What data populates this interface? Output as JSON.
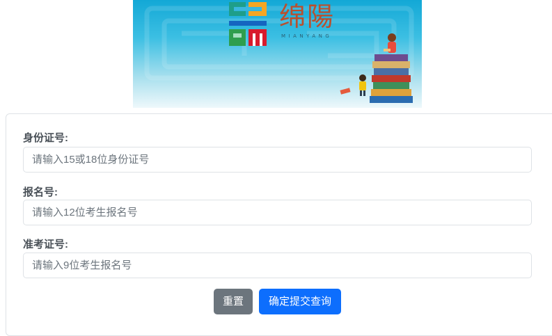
{
  "banner": {
    "logo_text": "绵陽",
    "logo_subtitle": "MIANYANG"
  },
  "form": {
    "fields": [
      {
        "label": "身份证号:",
        "placeholder": "请输入15或18位身份证号",
        "value": ""
      },
      {
        "label": "报名号:",
        "placeholder": "请输入12位考生报名号",
        "value": ""
      },
      {
        "label": "准考证号:",
        "placeholder": "请输入9位考生报名号",
        "value": ""
      }
    ],
    "reset_label": "重置",
    "submit_label": "确定提交查询"
  },
  "colors": {
    "secondary": "#6c757d",
    "primary": "#0d6efd",
    "label": "#495057",
    "border": "#dee2e6"
  }
}
